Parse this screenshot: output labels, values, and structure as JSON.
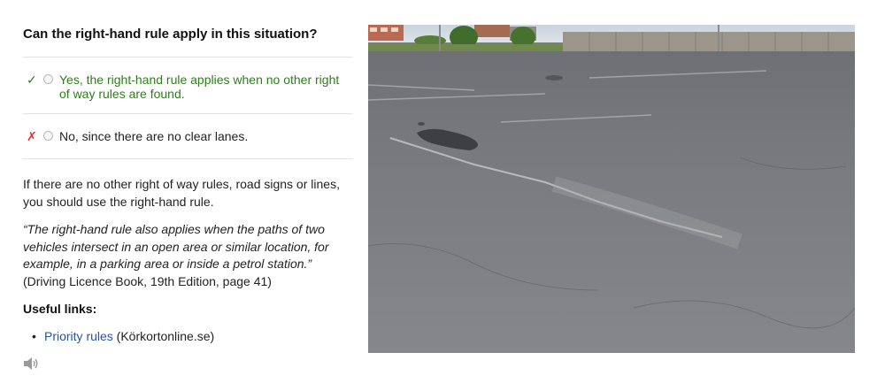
{
  "question": "Can the right-hand rule apply in this situation?",
  "answers": [
    {
      "mark": "✓",
      "text": "Yes, the right-hand rule applies when no other right of way rules are found.",
      "status": "correct"
    },
    {
      "mark": "✗",
      "text": "No, since there are no clear lanes.",
      "status": "wrong"
    }
  ],
  "explanation": "If there are no other right of way rules, road signs or lines, you should use the right-hand rule.",
  "quote": {
    "text": "“The right-hand rule also applies when the paths of two vehicles intersect in an open area or similar location, for example, in a parking area or inside a petrol station.”",
    "source": " (Driving Licence Book, 19th Edition, page 41)"
  },
  "useful_links": {
    "heading": "Useful links:",
    "items": [
      {
        "link_text": "Priority rules",
        "suffix": " (Körkortonline.se)"
      }
    ]
  },
  "icons": {
    "audio": "speaker-icon"
  },
  "colors": {
    "correct": "#2e7d1c",
    "wrong": "#d93535",
    "link": "#2455a4"
  }
}
